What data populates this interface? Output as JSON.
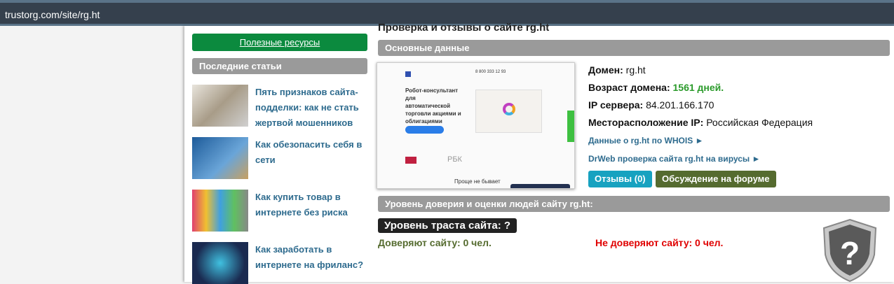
{
  "browser": {
    "url": "trustorg.com/site/rg.ht"
  },
  "sidebar": {
    "useful_resources": "Полезные ресурсы",
    "recent_articles": "Последние статьи",
    "articles": [
      {
        "title": "Пять признаков сайта-подделки: как не стать жертвой мошенников"
      },
      {
        "title": "Как обезопасить себя в сети"
      },
      {
        "title": "Как купить товар в интернете без риска"
      },
      {
        "title": "Как заработать в интернете на фриланс?"
      }
    ]
  },
  "main": {
    "title": "Проверка и отзывы о сайте rg.ht",
    "basic_header": "Основные данные",
    "screenshot": {
      "headline": "Робот-консультант для автоматической торговли акциями и облигациями",
      "phone": "8 800 333 12 93",
      "footer": "Проще не бывает",
      "partner": "РБК"
    },
    "domain_label": "Домен:",
    "domain": "rg.ht",
    "age_label": "Возраст домена:",
    "age": "1561 дней.",
    "ip_label": "IP сервера:",
    "ip": "84.201.166.170",
    "loc_label": "Месторасположение IP:",
    "loc": "Российская Федерация",
    "whois_link": "Данные о rg.ht по WHOIS ►",
    "drweb_link": "DrWeb проверка сайта rg.ht на вирусы ►",
    "reviews_btn": "Отзывы (0)",
    "forum_btn": "Обсуждение на форуме",
    "trust_header": "Уровень доверия и оценки людей сайту rg.ht:",
    "trust_level": "Уровень траста сайта: ?",
    "trust_yes": "Доверяют сайту: 0 чел.",
    "trust_no": "Не доверяют сайту: 0 чел.",
    "colors": {
      "green": "#0b8a3e",
      "teal": "#17a2c0",
      "olive": "#556b2f",
      "red": "#e00000"
    }
  }
}
